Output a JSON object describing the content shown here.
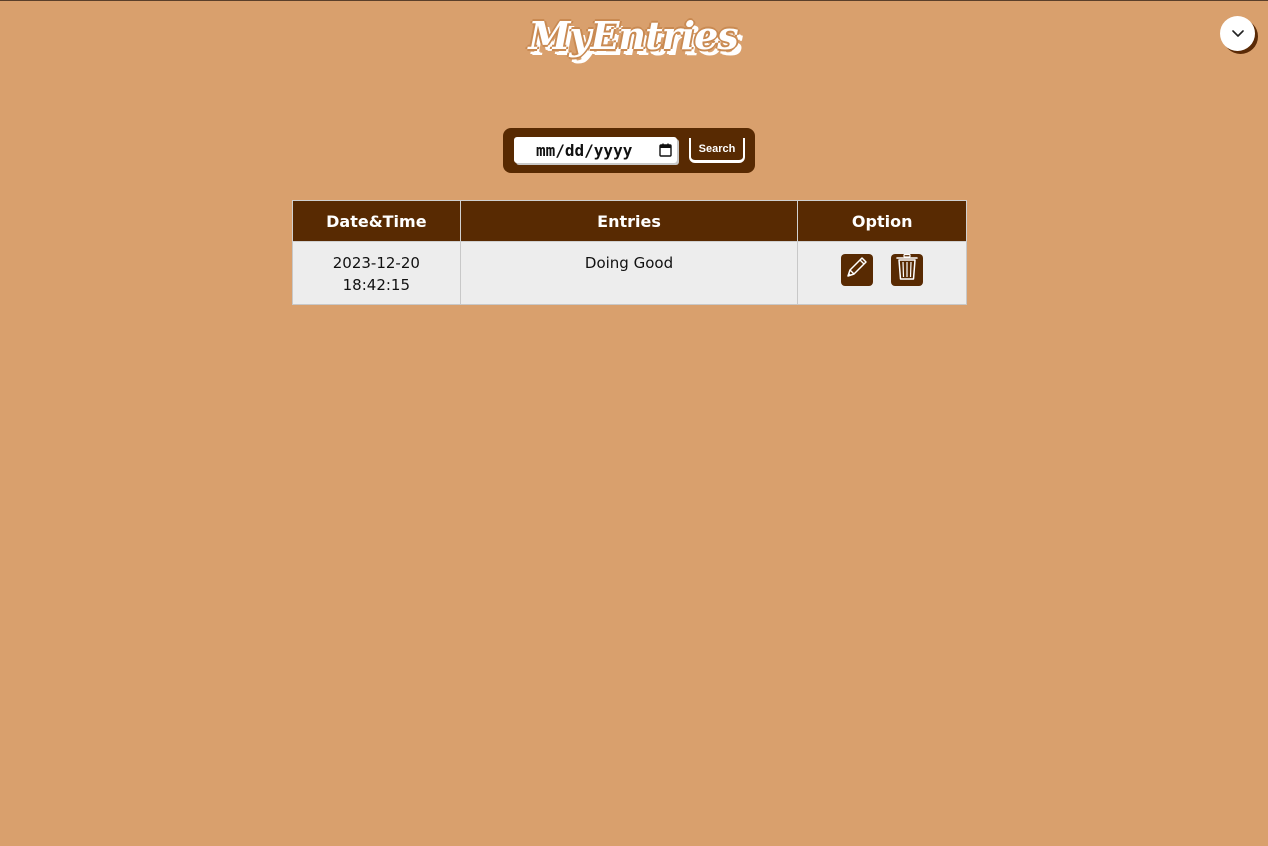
{
  "header": {
    "logo_text": "MyEntries",
    "menu_toggle_icon": "chevron-down-icon"
  },
  "search": {
    "date_placeholder": "mm/dd/yyyy",
    "button_label": "Search"
  },
  "table": {
    "columns": [
      "Date&Time",
      "Entries",
      "Option"
    ],
    "rows": [
      {
        "date": "2023-12-20",
        "time": "18:42:15",
        "entry": "Doing Good",
        "actions": [
          "pencil-icon",
          "trash-icon"
        ]
      }
    ]
  },
  "colors": {
    "background": "#d9a06d",
    "accent": "#582a02",
    "cell_background": "#ededed"
  }
}
